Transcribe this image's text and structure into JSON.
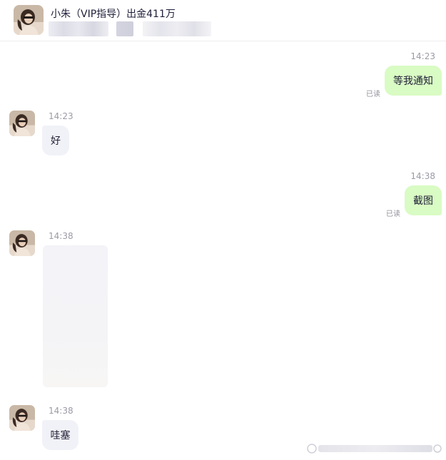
{
  "header": {
    "title": "小朱（VIP指导）出金411万",
    "avatar_icon": "profile-photo-avatar"
  },
  "messages": [
    {
      "side": "out",
      "time": "14:23",
      "text": "等我通知",
      "read": "已读"
    },
    {
      "side": "in",
      "time": "14:23",
      "text": "好"
    },
    {
      "side": "out",
      "time": "14:38",
      "text": "截图",
      "read": "已读"
    },
    {
      "side": "in",
      "time": "14:38",
      "type": "image"
    },
    {
      "side": "in",
      "time": "14:38",
      "text": "哇塞"
    }
  ],
  "colors": {
    "outgoing_bubble": "#d9fbc4",
    "incoming_bubble": "#f1f2f8",
    "timestamp": "#9a9aa6",
    "text": "#222238"
  }
}
